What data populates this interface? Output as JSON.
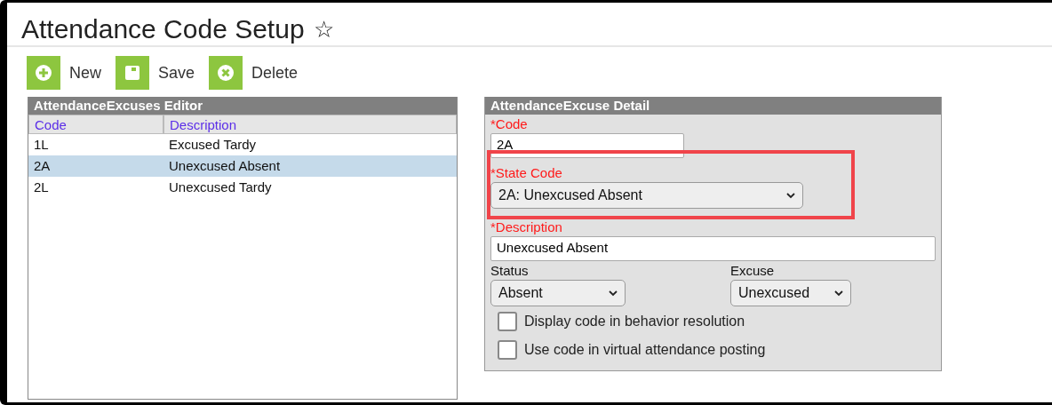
{
  "page": {
    "title": "Attendance Code Setup",
    "star": "☆"
  },
  "toolbar": [
    {
      "kind": "new",
      "label": "New"
    },
    {
      "kind": "save",
      "label": "Save"
    },
    {
      "kind": "delete",
      "label": "Delete"
    }
  ],
  "editor": {
    "title": "AttendanceExcuses Editor",
    "columns": [
      "Code",
      "Description"
    ],
    "rows": [
      {
        "code": "1L",
        "description": "Excused Tardy",
        "selected": false
      },
      {
        "code": "2A",
        "description": "Unexcused Absent",
        "selected": true
      },
      {
        "code": "2L",
        "description": "Unexcused Tardy",
        "selected": false
      }
    ]
  },
  "detail": {
    "title": "AttendanceExcuse Detail",
    "code": {
      "label": "*Code",
      "value": "2A"
    },
    "state_code": {
      "label": "*State Code",
      "value": "2A: Unexcused Absent",
      "highlighted": true
    },
    "description": {
      "label": "*Description",
      "value": "Unexcused Absent"
    },
    "status": {
      "label": "Status",
      "value": "Absent"
    },
    "excuse": {
      "label": "Excuse",
      "value": "Unexcused"
    },
    "checkboxes": [
      {
        "label": "Display code in behavior resolution",
        "checked": false
      },
      {
        "label": "Use code in virtual attendance posting",
        "checked": false
      }
    ]
  }
}
